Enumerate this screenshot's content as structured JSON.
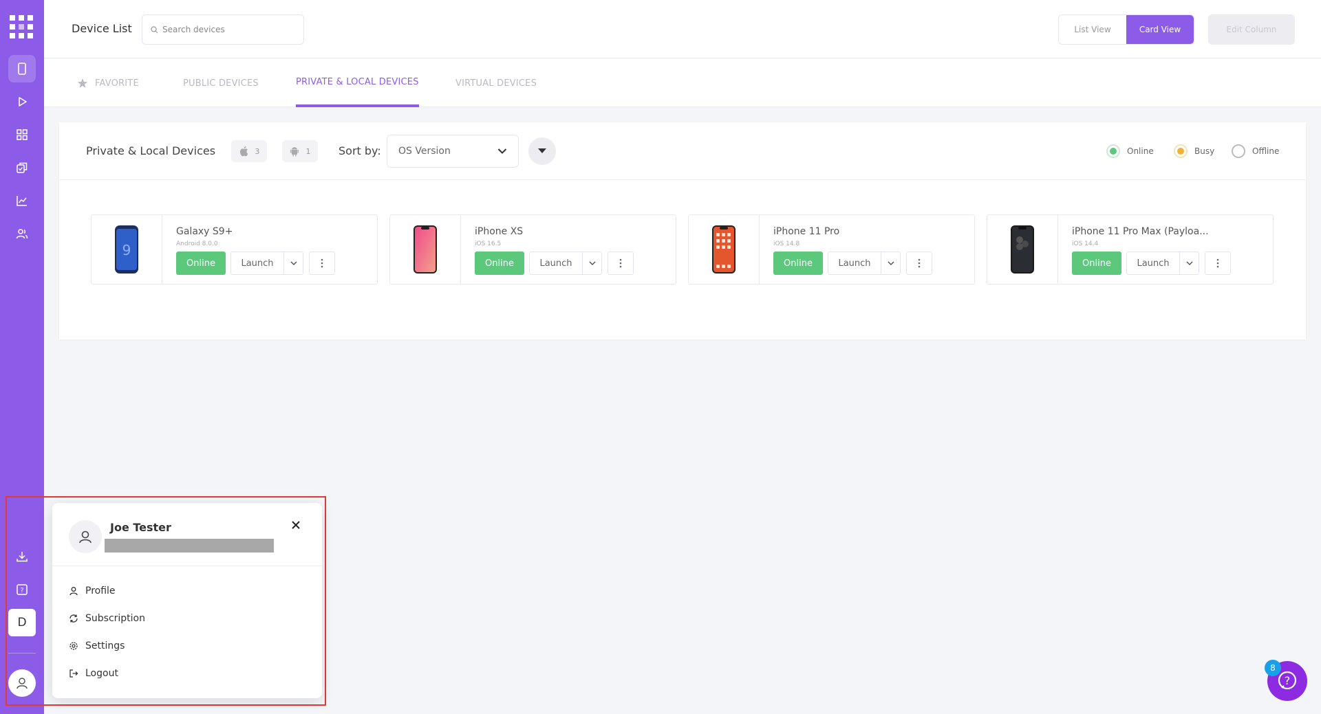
{
  "header": {
    "title": "Device List",
    "search_placeholder": "Search devices",
    "list_view": "List View",
    "card_view": "Card View",
    "edit_column": "Edit Column"
  },
  "tabs": [
    {
      "label": "FAVORITE",
      "icon": "star-icon"
    },
    {
      "label": "PUBLIC DEVICES"
    },
    {
      "label": "PRIVATE & LOCAL DEVICES",
      "active": true
    },
    {
      "label": "VIRTUAL DEVICES"
    }
  ],
  "panel": {
    "title": "Private & Local Devices",
    "ios_count": "3",
    "android_count": "1",
    "sort_label": "Sort by:",
    "sort_value": "OS Version",
    "legend": {
      "online": "Online",
      "busy": "Busy",
      "offline": "Offline"
    }
  },
  "devices": [
    {
      "name": "Galaxy S9+",
      "os": "Android 8.0.0",
      "status": "Online",
      "launch": "Launch"
    },
    {
      "name": "iPhone XS",
      "os": "iOS 16.5",
      "status": "Online",
      "launch": "Launch"
    },
    {
      "name": "iPhone 11 Pro",
      "os": "iOS 14.8",
      "status": "Online",
      "launch": "Launch"
    },
    {
      "name": "iPhone 11 Pro Max (Payloa...",
      "os": "iOS 14.4",
      "status": "Online",
      "launch": "Launch"
    }
  ],
  "sidebar": {
    "workspace_initial": "D"
  },
  "user_menu": {
    "name": "Joe Tester",
    "items": [
      "Profile",
      "Subscription",
      "Settings",
      "Logout"
    ]
  },
  "help": {
    "badge": "8"
  },
  "colors": {
    "accent": "#8c5ce8",
    "online": "#5cc87c",
    "busy": "#f2b134",
    "highlight": "#e53935"
  }
}
